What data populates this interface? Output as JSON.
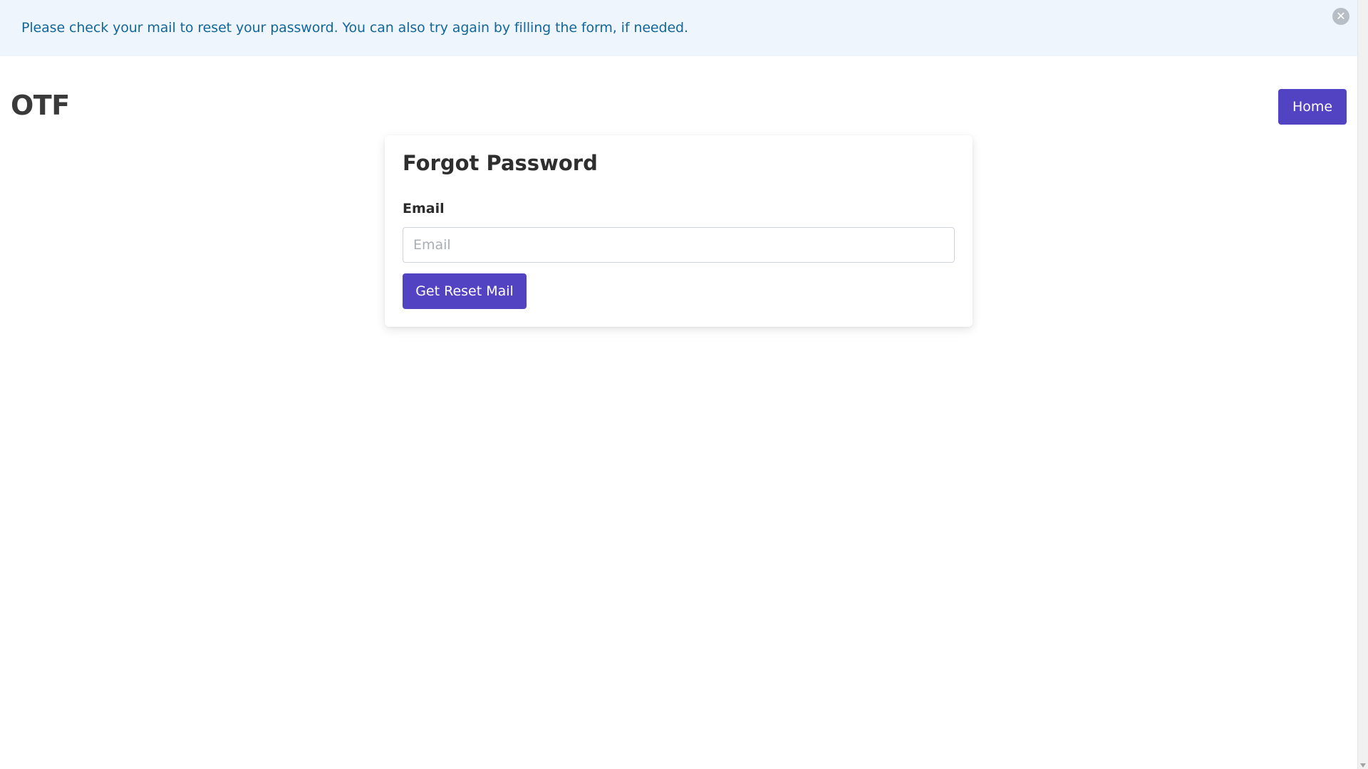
{
  "notice": {
    "message": "Please check your mail to reset your password. You can also try again by filling the form, if needed.",
    "close_icon": "close-icon",
    "close_glyph": "✕"
  },
  "header": {
    "brand": "OTF",
    "home_label": "Home"
  },
  "form": {
    "title": "Forgot Password",
    "email_label": "Email",
    "email_placeholder": "Email",
    "email_value": "",
    "submit_label": "Get Reset Mail"
  },
  "colors": {
    "primary": "#5243c2",
    "notice_bg": "#eef5fc",
    "notice_text": "#14679a"
  }
}
